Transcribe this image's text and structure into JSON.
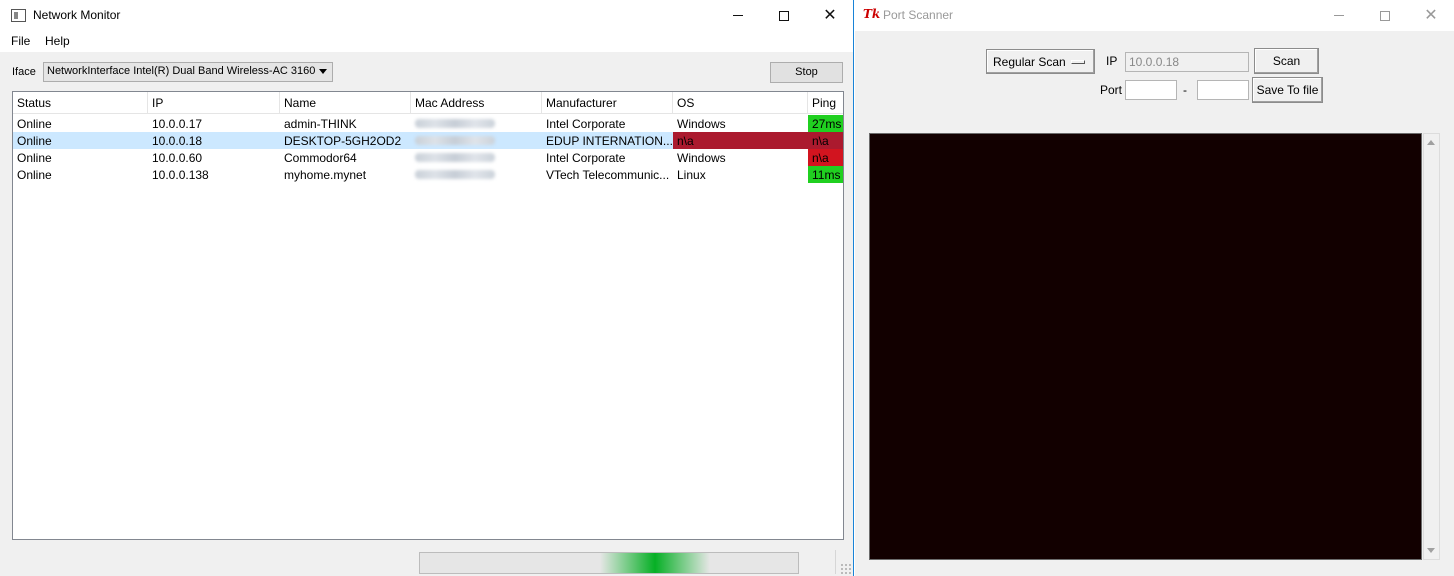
{
  "network_monitor": {
    "title": "Network Monitor",
    "menu": [
      "File",
      "Help"
    ],
    "iface_label": "Iface",
    "iface_value": "NetworkInterface Intel(R) Dual Band Wireless-AC 3160",
    "stop_label": "Stop",
    "columns": [
      "Status",
      "IP",
      "Name",
      "Mac Address",
      "Manufacturer",
      "OS",
      "Ping"
    ],
    "rows": [
      {
        "status": "Online",
        "ip": "10.0.0.17",
        "name": "admin-THINK",
        "manufacturer": "Intel Corporate",
        "os": "Windows",
        "ping": "27ms",
        "ping_color": "#20d020",
        "os_color": "",
        "selected": false
      },
      {
        "status": "Online",
        "ip": "10.0.0.18",
        "name": "DESKTOP-5GH2OD2",
        "manufacturer": "EDUP INTERNATION...",
        "os": "n\\a",
        "ping": "n\\a",
        "ping_color": "#ab1a2e",
        "os_color": "#ab1a2e",
        "selected": true
      },
      {
        "status": "Online",
        "ip": "10.0.0.60",
        "name": "Commodor64",
        "manufacturer": "Intel Corporate",
        "os": "Windows",
        "ping": "n\\a",
        "ping_color": "#d2141f",
        "os_color": "",
        "selected": false
      },
      {
        "status": "Online",
        "ip": "10.0.0.138",
        "name": "myhome.mynet",
        "manufacturer": "VTech Telecommunic...",
        "os": "Linux",
        "ping": "11ms",
        "ping_color": "#20d020",
        "os_color": "",
        "selected": false
      }
    ],
    "progress_color": "#06b025"
  },
  "port_scanner": {
    "title": "Port Scanner",
    "scan_type": "Regular Scan",
    "ip_label": "IP",
    "ip_value": "10.0.0.18",
    "scan_label": "Scan",
    "port_label": "Port",
    "port_dash": "-",
    "save_label": "Save To file",
    "output_bg": "#120000"
  }
}
